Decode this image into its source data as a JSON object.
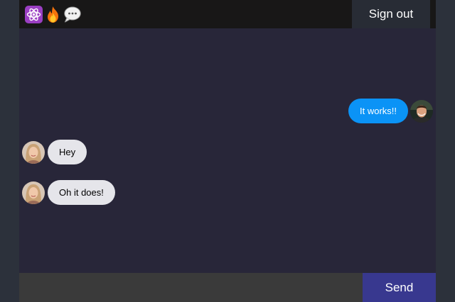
{
  "header": {
    "logo_icons": [
      "atom-icon",
      "fire-icon",
      "speech-bubble-icon"
    ],
    "signout_label": "Sign out"
  },
  "messages": [
    {
      "from": "me",
      "text": "It works!!",
      "avatar": "male-user-avatar"
    },
    {
      "from": "other",
      "text": "Hey",
      "avatar": "female-user-avatar"
    },
    {
      "from": "other",
      "text": "Oh it does!",
      "avatar": "female-user-avatar"
    }
  ],
  "composer": {
    "input_value": "",
    "send_label": "Send"
  },
  "colors": {
    "page_bg": "#2c313b",
    "chat_bg": "#282639",
    "header_bg": "#181717",
    "sent_bubble": "#0b93f6",
    "received_bubble": "#e5e5ea",
    "send_button": "#38388f",
    "composer_bg": "#3a3a3a"
  }
}
